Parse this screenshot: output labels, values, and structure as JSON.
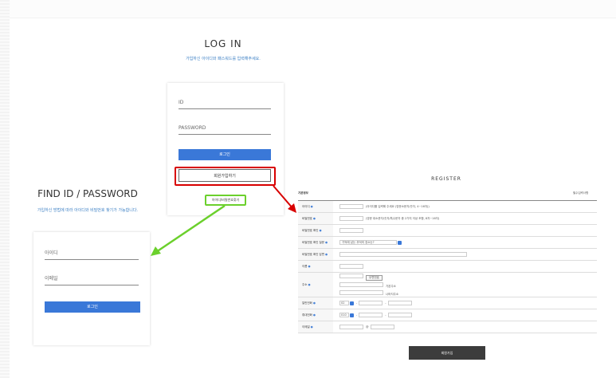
{
  "login": {
    "title": "LOG IN",
    "subtitle": "가입하신 아이디와 패스워드를 입력해주세요.",
    "id_placeholder": "ID",
    "password_placeholder": "PASSWORD",
    "login_button": "로그인",
    "join_button": "회원가입하기",
    "find_link": "아이디/비밀번호찾기"
  },
  "find": {
    "title": "FIND ID / PASSWORD",
    "subtitle": "가입하신 방법에 따라 아이디와 비밀번호 찾기가 가능합니다.",
    "id_placeholder": "아이디",
    "email_placeholder": "이메일",
    "login_button": "로그인"
  },
  "register": {
    "title": "REGISTER",
    "section": "기본정보",
    "required_note": "필수입력사항",
    "fields": {
      "id": {
        "label": "아이디",
        "hint": "(아이디를 입력해 주세요 (영문소문자/숫자, 4~16자))"
      },
      "password": {
        "label": "비밀번호",
        "hint": "(영문 대소문자/숫자/특수문자 중 2가지 이상 조합, 8자~16자)"
      },
      "password_confirm": {
        "label": "비밀번호 확인"
      },
      "question": {
        "label": "비밀번호 확인 질문",
        "value": "기억에 남는 추억의 장소는?"
      },
      "answer": {
        "label": "비밀번호 확인 답변"
      },
      "name": {
        "label": "이름"
      },
      "address": {
        "label": "주소",
        "zip_button": "우편번호",
        "basic": "기본주소",
        "detail": "나머지주소"
      },
      "phone": {
        "label": "일반전화",
        "prefix": "02"
      },
      "mobile": {
        "label": "휴대전화",
        "prefix": "010"
      },
      "email": {
        "label": "이메일",
        "at": "@"
      }
    },
    "submit": "회원가입"
  },
  "colors": {
    "accent": "#3a78d8",
    "highlight_red": "#d80000",
    "highlight_green": "#6bd02c"
  }
}
